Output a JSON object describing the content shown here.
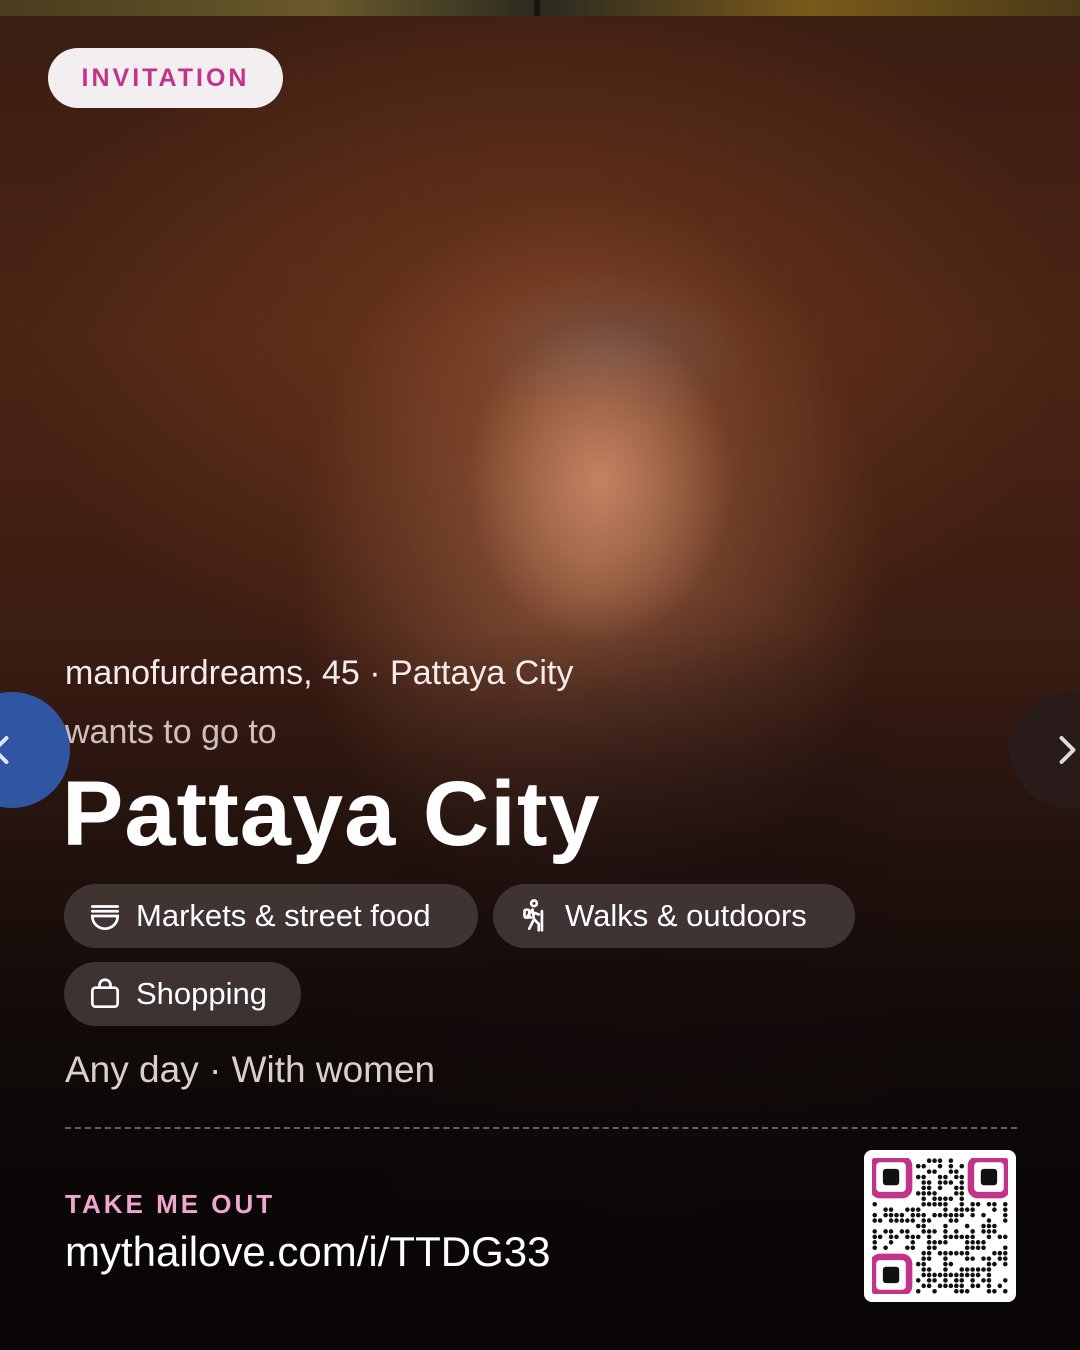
{
  "badge": {
    "label": "INVITATION"
  },
  "host": {
    "line": "manofurdreams, 45 · Pattaya City"
  },
  "intro": "wants to go to",
  "destination": "Pattaya City",
  "interests": [
    {
      "icon": "bowl-icon",
      "label": "Markets & street food"
    },
    {
      "icon": "hiking-icon",
      "label": "Walks & outdoors"
    },
    {
      "icon": "shopping-bag-icon",
      "label": "Shopping"
    }
  ],
  "meta": "Any day · With women",
  "cta": {
    "label": "TAKE ME OUT",
    "link": "mythailove.com/i/TTDG33"
  },
  "colors": {
    "accent": "#c2338a",
    "cta_pink": "#f1a6cf",
    "prev_button": "#2f55a3"
  }
}
